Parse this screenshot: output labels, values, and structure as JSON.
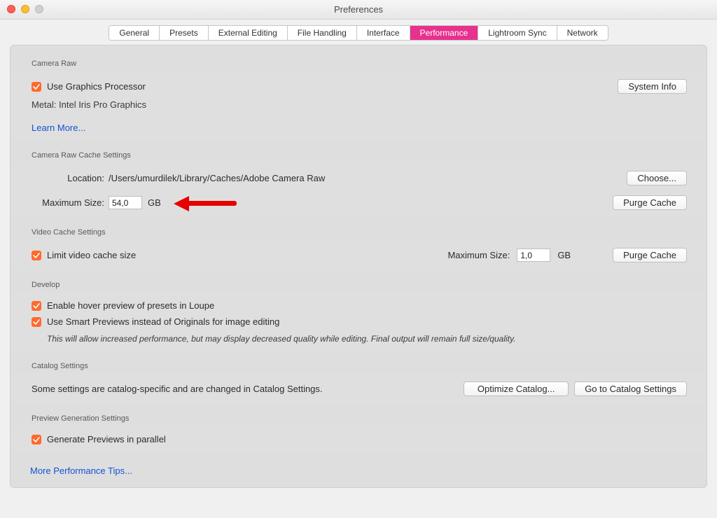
{
  "window": {
    "title": "Preferences"
  },
  "tabs": {
    "general": "General",
    "presets": "Presets",
    "external_editing": "External Editing",
    "file_handling": "File Handling",
    "interface": "Interface",
    "performance": "Performance",
    "lightroom_sync": "Lightroom Sync",
    "network": "Network",
    "active": "performance"
  },
  "camera_raw": {
    "section": "Camera Raw",
    "use_gpu_label": "Use Graphics Processor",
    "gpu_desc": "Metal: Intel Iris Pro Graphics",
    "learn_more": "Learn More...",
    "system_info_btn": "System Info"
  },
  "crc_cache": {
    "section": "Camera Raw Cache Settings",
    "location_label": "Location:",
    "location_value": "/Users/umurdilek/Library/Caches/Adobe Camera Raw",
    "choose_btn": "Choose...",
    "max_size_label": "Maximum Size:",
    "max_size_value": "54,0",
    "unit": "GB",
    "purge_btn": "Purge Cache"
  },
  "video_cache": {
    "section": "Video Cache Settings",
    "limit_label": "Limit video cache size",
    "max_size_label": "Maximum Size:",
    "max_size_value": "1,0",
    "unit": "GB",
    "purge_btn": "Purge Cache"
  },
  "develop": {
    "section": "Develop",
    "hover_label": "Enable hover preview of presets in Loupe",
    "smart_label": "Use Smart Previews instead of Originals for image editing",
    "note": "This will allow increased performance, but may display decreased quality while editing. Final output will remain full size/quality."
  },
  "catalog": {
    "section": "Catalog Settings",
    "text": "Some settings are catalog-specific and are changed in Catalog Settings.",
    "optimize_btn": "Optimize Catalog...",
    "goto_btn": "Go to Catalog Settings"
  },
  "preview_gen": {
    "section": "Preview Generation Settings",
    "parallel_label": "Generate Previews in parallel"
  },
  "footer": {
    "more_tips": "More Performance Tips..."
  }
}
